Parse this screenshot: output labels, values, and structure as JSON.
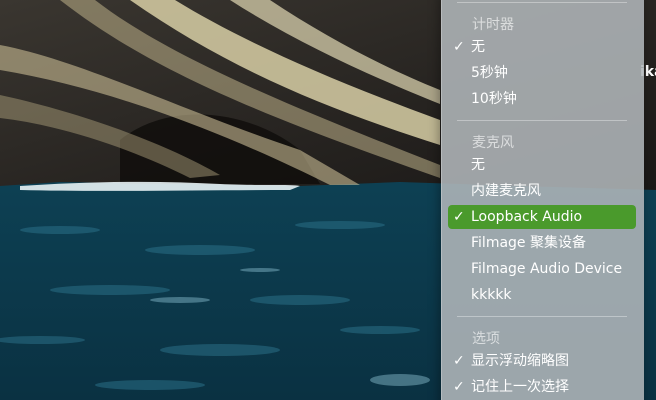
{
  "menu": {
    "timer_title": "计时器",
    "timer_items": [
      {
        "label": "无",
        "checked": true
      },
      {
        "label": "5秒钟",
        "checked": false
      },
      {
        "label": "10秒钟",
        "checked": false
      }
    ],
    "mic_title": "麦克风",
    "mic_items": [
      {
        "label": "无",
        "checked": false
      },
      {
        "label": "内建麦克风",
        "checked": false
      },
      {
        "label": "Loopback Audio",
        "checked": true
      },
      {
        "label": "Filmage 聚集设备",
        "checked": false
      },
      {
        "label": "Filmage Audio Device",
        "checked": false
      },
      {
        "label": "kkkkk",
        "checked": false
      }
    ],
    "options_title": "选项",
    "options_items": [
      {
        "label": "显示浮动缩略图",
        "checked": true
      },
      {
        "label": "记住上一次选择",
        "checked": true
      }
    ],
    "check_glyph": "✓",
    "highlight_color": "#4a9a2c"
  },
  "background": {
    "description_icon": "cliff-sea-wallpaper",
    "peek_text": "ika"
  }
}
